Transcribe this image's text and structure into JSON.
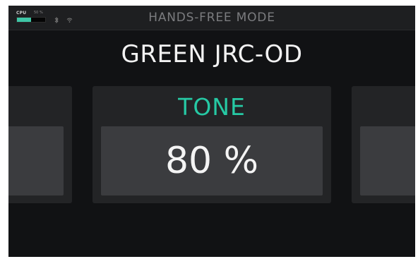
{
  "status": {
    "cpu_label": "CPU",
    "cpu_percent_text": "50 %",
    "cpu_usage_fraction": 0.5,
    "cpu_bar_color": "#3fc6a6",
    "icons": [
      "bluetooth-icon",
      "wifi-icon"
    ]
  },
  "header": {
    "title": "HANDS-FREE MODE"
  },
  "preset": {
    "name": "GREEN JRC-OD"
  },
  "parameter": {
    "label": "TONE",
    "value": "80 %",
    "label_color": "#26c9a4"
  },
  "neighbors": {
    "previous": {
      "label": "",
      "value": ""
    },
    "next": {
      "label": "",
      "value": ""
    }
  }
}
